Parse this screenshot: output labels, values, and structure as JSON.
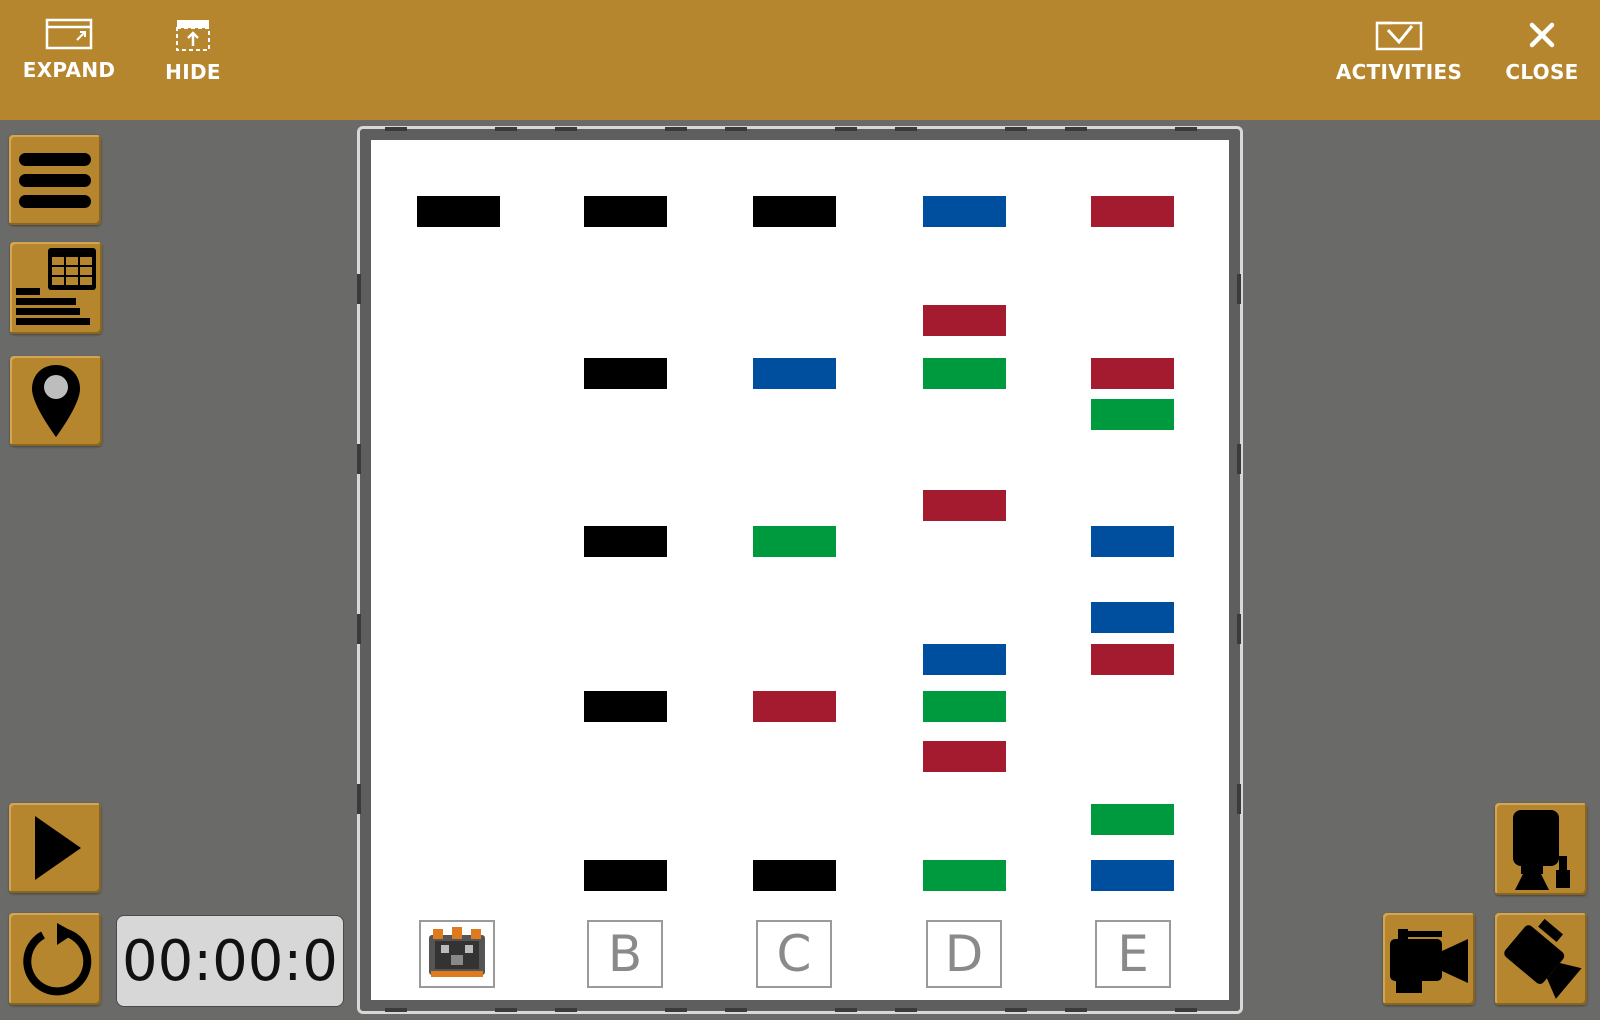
{
  "topbar": {
    "expand_label": "EXPAND",
    "hide_label": "HIDE",
    "activities_label": "ACTIVITIES",
    "close_label": "CLOSE"
  },
  "timer": {
    "value": "00:00:0"
  },
  "colors": {
    "gold": "#b5862e",
    "black": "#000000",
    "blue": "#004f9e",
    "red": "#a41a2f",
    "green": "#009a3e"
  },
  "field": {
    "columns": [
      "",
      "B",
      "C",
      "D",
      "E"
    ],
    "blocks": [
      {
        "col": 0,
        "row": 0,
        "color": "black"
      },
      {
        "col": 1,
        "row": 0,
        "color": "black"
      },
      {
        "col": 2,
        "row": 0,
        "color": "black"
      },
      {
        "col": 3,
        "row": 0,
        "color": "blue"
      },
      {
        "col": 4,
        "row": 0,
        "color": "red"
      },
      {
        "col": 3,
        "row": 1,
        "color": "red"
      },
      {
        "col": 1,
        "row": 2,
        "color": "black"
      },
      {
        "col": 2,
        "row": 2,
        "color": "blue"
      },
      {
        "col": 3,
        "row": 2,
        "color": "green"
      },
      {
        "col": 4,
        "row": 2,
        "color": "red"
      },
      {
        "col": 4,
        "row": 3,
        "color": "green"
      },
      {
        "col": 3,
        "row": 4,
        "color": "red"
      },
      {
        "col": 1,
        "row": 5,
        "color": "black"
      },
      {
        "col": 2,
        "row": 5,
        "color": "green"
      },
      {
        "col": 4,
        "row": 5,
        "color": "blue"
      },
      {
        "col": 4,
        "row": 6,
        "color": "blue"
      },
      {
        "col": 3,
        "row": 7,
        "color": "blue"
      },
      {
        "col": 4,
        "row": 7,
        "color": "red"
      },
      {
        "col": 1,
        "row": 8,
        "color": "black"
      },
      {
        "col": 2,
        "row": 8,
        "color": "red"
      },
      {
        "col": 3,
        "row": 8,
        "color": "green"
      },
      {
        "col": 3,
        "row": 9,
        "color": "red"
      },
      {
        "col": 4,
        "row": 10,
        "color": "green"
      },
      {
        "col": 1,
        "row": 11,
        "color": "black"
      },
      {
        "col": 2,
        "row": 11,
        "color": "black"
      },
      {
        "col": 3,
        "row": 11,
        "color": "green"
      },
      {
        "col": 4,
        "row": 11,
        "color": "blue"
      }
    ]
  },
  "icons": {
    "expand": "expand-window-icon",
    "hide": "hide-window-icon",
    "activities": "activities-icon",
    "close": "close-icon",
    "menu": "menu-icon",
    "data_table": "data-table-icon",
    "location": "location-pin-icon",
    "play": "play-icon",
    "reset": "reset-icon",
    "robot": "robot-icon",
    "camera_1": "camera-follow-icon",
    "camera_2": "camera-side-icon",
    "camera_3": "camera-top-icon"
  }
}
